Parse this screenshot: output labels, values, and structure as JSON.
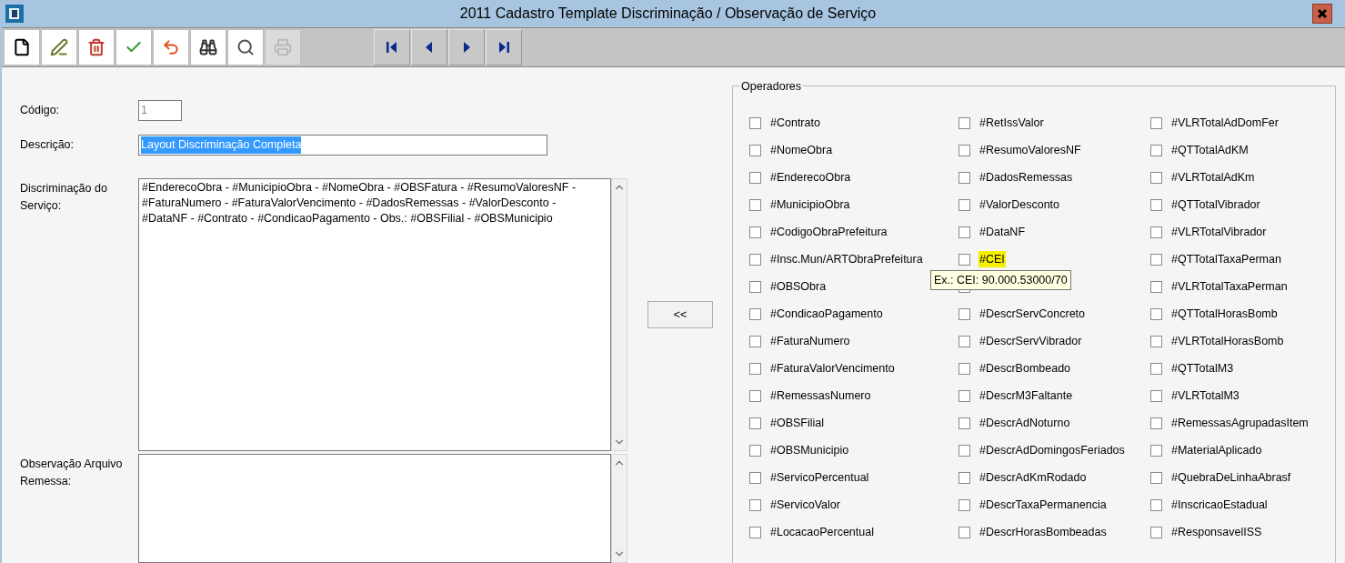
{
  "window": {
    "title": "2011 Cadastro Template Discriminação / Observação de Serviço"
  },
  "toolbar": [
    {
      "kind": "new",
      "disabled": false
    },
    {
      "kind": "edit",
      "disabled": false
    },
    {
      "kind": "delete",
      "disabled": false
    },
    {
      "kind": "save",
      "disabled": false
    },
    {
      "kind": "undo",
      "disabled": false
    },
    {
      "kind": "find",
      "disabled": false
    },
    {
      "kind": "search",
      "disabled": false
    },
    {
      "kind": "print",
      "disabled": true
    }
  ],
  "navigation": [
    {
      "kind": "first"
    },
    {
      "kind": "prev"
    },
    {
      "kind": "next"
    },
    {
      "kind": "last"
    }
  ],
  "form": {
    "codigo": {
      "label": "Código:",
      "value": "1"
    },
    "descricao": {
      "label": "Descrição:",
      "value": "Layout Discriminação Completa",
      "selected": true
    },
    "discriminacao": {
      "label": "Discriminação do Serviço:",
      "lines": [
        "#EnderecoObra - #MunicipioObra - #NomeObra - #OBSFatura - #ResumoValoresNF -",
        "#FaturaNumero - #FaturaValorVencimento - #DadosRemessas - #ValorDesconto -",
        "#DataNF - #Contrato - #CondicaoPagamento - Obs.: #OBSFilial - #OBSMunicipio"
      ]
    },
    "observacao": {
      "label": "Observação Arquivo Remessa:"
    }
  },
  "move_button": "<<",
  "operadores": {
    "title": "Operadores",
    "tooltip": "Ex.: CEI: 90.000.53000/70",
    "columns": [
      [
        {
          "label": "#Contrato",
          "checked": false,
          "highlighted": false
        },
        {
          "label": "#NomeObra",
          "checked": false,
          "highlighted": false
        },
        {
          "label": "#EnderecoObra",
          "checked": false,
          "highlighted": false
        },
        {
          "label": "#MunicipioObra",
          "checked": false,
          "highlighted": false
        },
        {
          "label": "#CodigoObraPrefeitura",
          "checked": false,
          "highlighted": false
        },
        {
          "label": "#Insc.Mun/ARTObraPrefeitura",
          "checked": false,
          "highlighted": false
        },
        {
          "label": "#OBSObra",
          "checked": false,
          "highlighted": false
        },
        {
          "label": "#CondicaoPagamento",
          "checked": false,
          "highlighted": false
        },
        {
          "label": "#FaturaNumero",
          "checked": false,
          "highlighted": false
        },
        {
          "label": "#FaturaValorVencimento",
          "checked": false,
          "highlighted": false
        },
        {
          "label": "#RemessasNumero",
          "checked": false,
          "highlighted": false
        },
        {
          "label": "#OBSFilial",
          "checked": false,
          "highlighted": false
        },
        {
          "label": "#OBSMunicipio",
          "checked": false,
          "highlighted": false
        },
        {
          "label": "#ServicoPercentual",
          "checked": false,
          "highlighted": false
        },
        {
          "label": "#ServicoValor",
          "checked": false,
          "highlighted": false
        },
        {
          "label": "#LocacaoPercentual",
          "checked": false,
          "highlighted": false
        }
      ],
      [
        {
          "label": "#RetIssValor",
          "checked": false,
          "highlighted": false
        },
        {
          "label": "#ResumoValoresNF",
          "checked": false,
          "highlighted": false
        },
        {
          "label": "#DadosRemessas",
          "checked": false,
          "highlighted": false
        },
        {
          "label": "#ValorDesconto",
          "checked": false,
          "highlighted": false
        },
        {
          "label": "#DataNF",
          "checked": false,
          "highlighted": false
        },
        {
          "label": "#CEI",
          "checked": false,
          "highlighted": true,
          "tooltip": true
        },
        {
          "checked": false
        },
        {
          "label": "#DescrServConcreto",
          "checked": false,
          "highlighted": false
        },
        {
          "label": "#DescrServVibrador",
          "checked": false,
          "highlighted": false
        },
        {
          "label": "#DescrBombeado",
          "checked": false,
          "highlighted": false
        },
        {
          "label": "#DescrM3Faltante",
          "checked": false,
          "highlighted": false
        },
        {
          "label": "#DescrAdNoturno",
          "checked": false,
          "highlighted": false
        },
        {
          "label": "#DescrAdDomingosFeriados",
          "checked": false,
          "highlighted": false
        },
        {
          "label": "#DescrAdKmRodado",
          "checked": false,
          "highlighted": false
        },
        {
          "label": "#DescrTaxaPermanencia",
          "checked": false,
          "highlighted": false
        },
        {
          "label": "#DescrHorasBombeadas",
          "checked": false,
          "highlighted": false
        }
      ],
      [
        {
          "label": "#VLRTotalAdDomFer",
          "checked": false,
          "highlighted": false
        },
        {
          "label": "#QTTotalAdKM",
          "checked": false,
          "highlighted": false
        },
        {
          "label": "#VLRTotalAdKm",
          "checked": false,
          "highlighted": false
        },
        {
          "label": "#QTTotalVibrador",
          "checked": false,
          "highlighted": false
        },
        {
          "label": "#VLRTotalVibrador",
          "checked": false,
          "highlighted": false
        },
        {
          "label": "#QTTotalTaxaPerman",
          "checked": false,
          "highlighted": false
        },
        {
          "label": "#VLRTotalTaxaPerman",
          "checked": false,
          "highlighted": false
        },
        {
          "label": "#QTTotalHorasBomb",
          "checked": false,
          "highlighted": false
        },
        {
          "label": "#VLRTotalHorasBomb",
          "checked": false,
          "highlighted": false
        },
        {
          "label": "#QTTotalM3",
          "checked": false,
          "highlighted": false
        },
        {
          "label": "#VLRTotalM3",
          "checked": false,
          "highlighted": false
        },
        {
          "label": "#RemessasAgrupadasItem",
          "checked": false,
          "highlighted": false
        },
        {
          "label": "#MaterialAplicado",
          "checked": false,
          "highlighted": false
        },
        {
          "label": "#QuebraDeLinhaAbrasf",
          "checked": false,
          "highlighted": false
        },
        {
          "label": "#InscricaoEstadual",
          "checked": false,
          "highlighted": false
        },
        {
          "label": "#ResponsavelISS",
          "checked": false,
          "highlighted": false
        }
      ]
    ]
  }
}
